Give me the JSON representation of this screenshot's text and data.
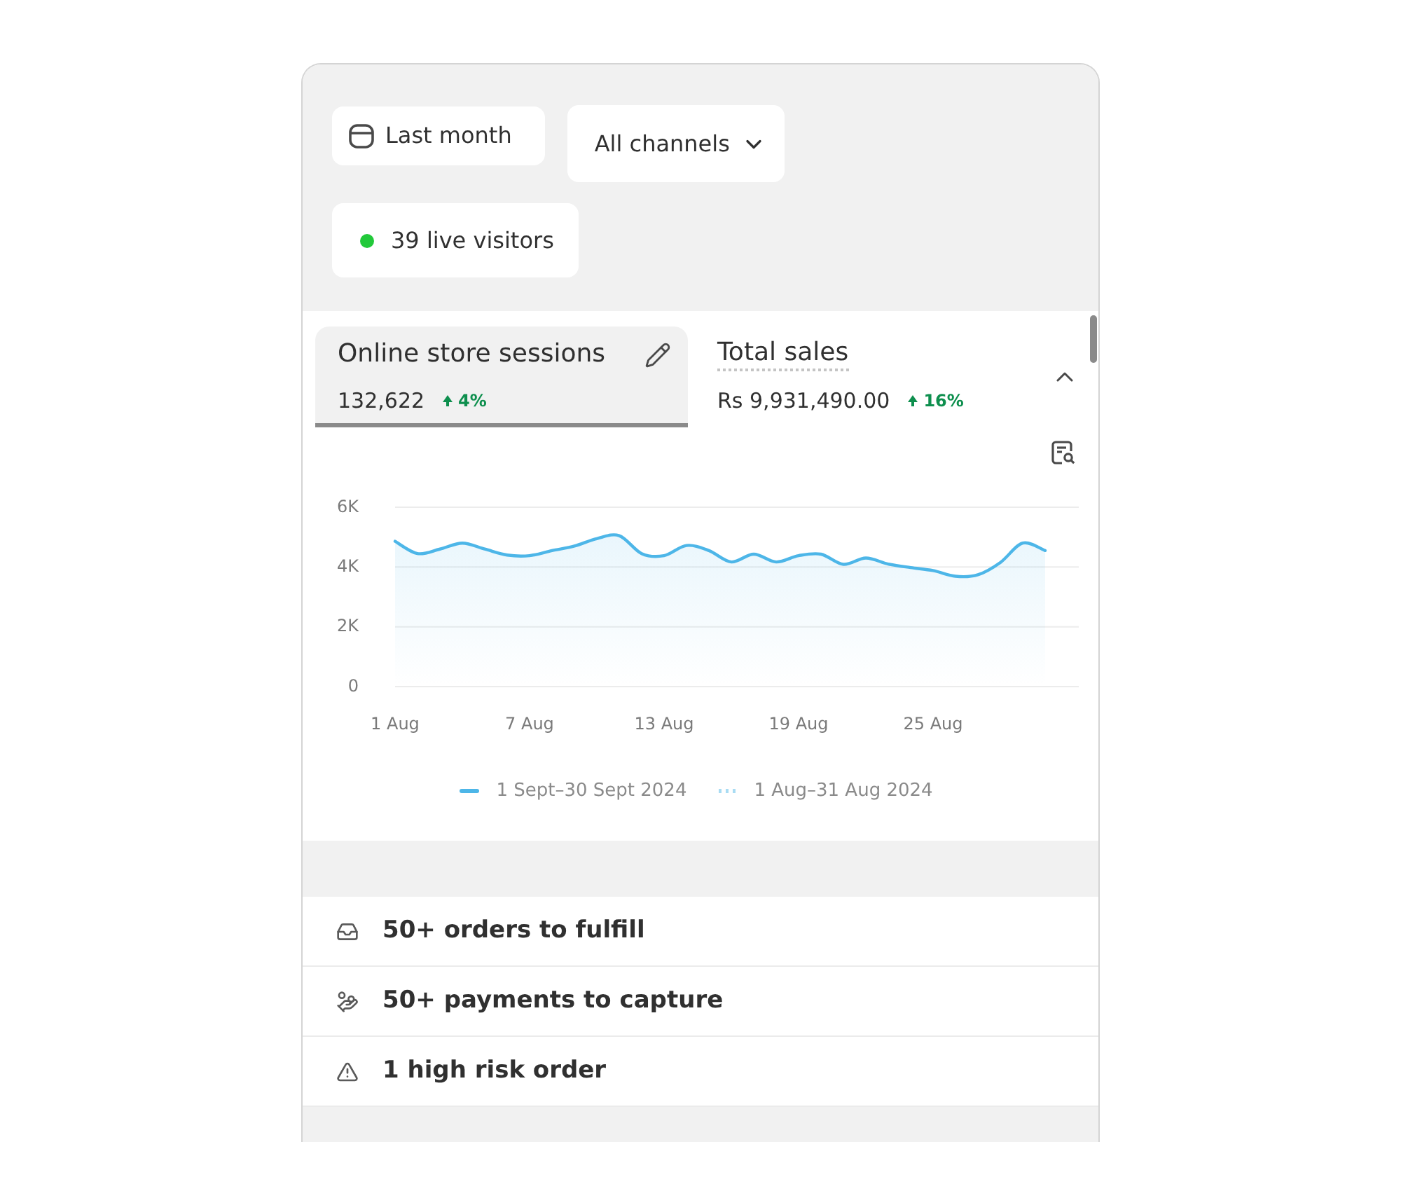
{
  "filters": [
    {
      "kind": "date",
      "label": "Last month"
    },
    {
      "kind": "dropdown",
      "label": "All channels"
    }
  ],
  "live_visitors": {
    "label": "39 live visitors"
  },
  "metrics": {
    "expanded": true,
    "tabs": [
      {
        "title": "Online store sessions",
        "value": "132,622",
        "change": "4%",
        "selected": true
      },
      {
        "title": "Total sales",
        "value": "Rs 9,931,490.00",
        "change": "16%",
        "selected": false
      }
    ]
  },
  "chart_data": {
    "type": "line",
    "categories": [
      "1 Aug",
      null,
      null,
      null,
      null,
      null,
      "7 Aug",
      null,
      null,
      null,
      null,
      null,
      "13 Aug",
      null,
      null,
      null,
      null,
      null,
      "19 Aug",
      null,
      null,
      null,
      null,
      null,
      "25 Aug",
      null,
      null,
      null,
      null,
      null
    ],
    "ylim": [
      0,
      6000
    ],
    "yticks": [
      {
        "value": 0,
        "label": "0"
      },
      {
        "value": 2000,
        "label": "2K"
      },
      {
        "value": 4000,
        "label": "4K"
      },
      {
        "value": 6000,
        "label": "6K"
      }
    ],
    "series": [
      {
        "name": "1 Sept–30 Sept 2024",
        "color": "#4db6e8",
        "values": [
          4860,
          4450,
          4600,
          4800,
          4600,
          4400,
          4380,
          4550,
          4700,
          4950,
          5050,
          4450,
          4380,
          4720,
          4550,
          4170,
          4430,
          4170,
          4380,
          4430,
          4090,
          4300,
          4100,
          3980,
          3880,
          3690,
          3740,
          4150,
          4800,
          4550
        ]
      },
      {
        "name": "1 Aug–31 Aug 2024",
        "color": "#a9dcf3",
        "values": [
          null,
          null,
          null,
          null,
          null,
          null,
          null,
          null,
          null,
          null,
          null,
          null,
          null,
          null,
          null,
          null,
          null,
          null,
          null,
          null,
          null,
          null,
          null,
          null,
          null,
          null,
          null,
          null,
          null,
          null
        ]
      }
    ]
  },
  "tasks": [
    {
      "kind": "orders",
      "label": "50+ orders to fulfill"
    },
    {
      "kind": "payments",
      "label": "50+ payments to capture"
    },
    {
      "kind": "risk",
      "label": "1 high risk order"
    }
  ]
}
